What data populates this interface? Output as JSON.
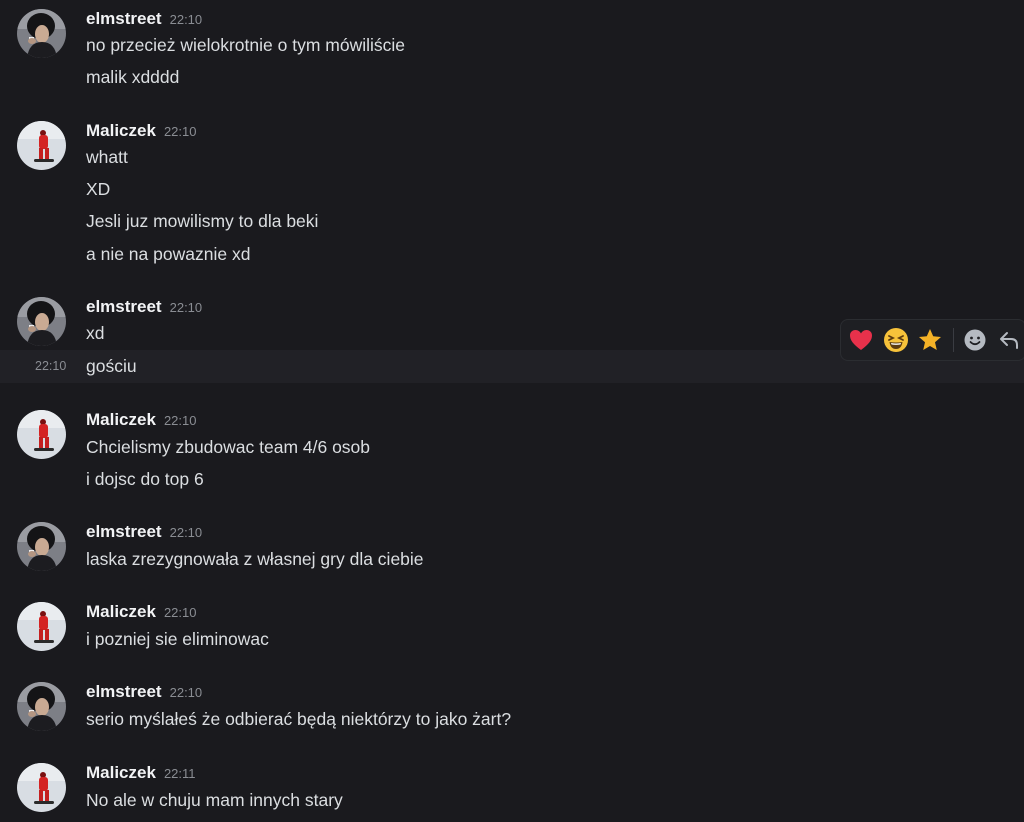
{
  "users": {
    "elmstreet": "elmstreet",
    "maliczek": "Maliczek"
  },
  "messages": [
    {
      "author": "elmstreet",
      "time": "22:10",
      "lines": [
        "no przecież wielokrotnie o tym mówiliście",
        "malik xdddd"
      ]
    },
    {
      "author": "Maliczek",
      "time": "22:10",
      "lines": [
        "whatt",
        "XD",
        "Jesli juz mowilismy to dla beki",
        "a nie na powaznie xd"
      ]
    },
    {
      "author": "elmstreet",
      "time": "22:10",
      "lines": [
        "xd"
      ]
    },
    {
      "author": "Maliczek",
      "time": "22:10",
      "lines": [
        "Chcielismy zbudowac team 4/6 osob",
        "i dojsc do top 6"
      ]
    },
    {
      "author": "elmstreet",
      "time": "22:10",
      "lines": [
        "laska zrezygnowała z własnej gry dla ciebie"
      ]
    },
    {
      "author": "Maliczek",
      "time": "22:10",
      "lines": [
        "i pozniej sie eliminowac"
      ]
    },
    {
      "author": "elmstreet",
      "time": "22:10",
      "lines": [
        "serio myślałeś że odbierać będą niektórzy to jako żart?"
      ]
    },
    {
      "author": "Maliczek",
      "time": "22:11",
      "lines": [
        "No ale w chuju mam innych stary"
      ]
    }
  ],
  "hovered_message": {
    "time": "22:10",
    "text": "gościu"
  },
  "toolbar": {
    "reactions": [
      "heart-icon",
      "laughing-face-icon",
      "star-icon"
    ],
    "actions": [
      "add-reaction-icon",
      "reply-icon"
    ]
  },
  "colors": {
    "background": "#1a1a1e",
    "hover_row": "#212126",
    "username": "#f2f3f5",
    "text": "#dbdee1",
    "timestamp": "#8a8d93",
    "heart": "#e8314b",
    "star": "#f5b227"
  }
}
